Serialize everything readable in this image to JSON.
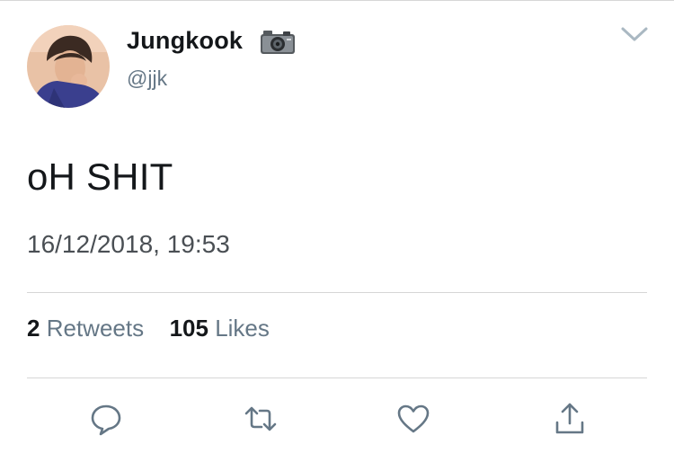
{
  "tweet": {
    "author": {
      "display_name": "Jungkook",
      "name_emoji": "camera-icon",
      "handle": "@jjk"
    },
    "text": "oH SHIT",
    "timestamp": "16/12/2018, 19:53",
    "stats": {
      "retweets_count": "2",
      "retweets_label": "Retweets",
      "likes_count": "105",
      "likes_label": "Likes"
    },
    "actions": [
      "reply-icon",
      "retweet-icon",
      "like-icon",
      "share-icon"
    ]
  },
  "colors": {
    "primary_text": "#14171a",
    "secondary_text": "#657786",
    "divider": "#d6d6d6",
    "icon": "#657786"
  }
}
